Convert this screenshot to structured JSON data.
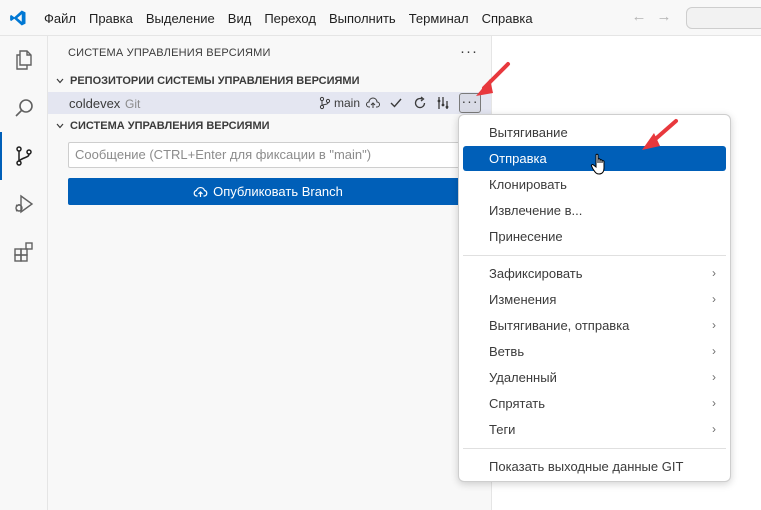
{
  "menubar": {
    "items": [
      "Файл",
      "Правка",
      "Выделение",
      "Вид",
      "Переход",
      "Выполнить",
      "Терминал",
      "Справка"
    ]
  },
  "activity_bar": {
    "items": [
      "explorer-icon",
      "search-icon",
      "source-control-icon",
      "run-debug-icon",
      "extensions-icon"
    ],
    "active": "source-control-icon"
  },
  "sidebar": {
    "header": "СИСТЕМА УПРАВЛЕНИЯ ВЕРСИЯМИ",
    "repos_section_title": "РЕПОЗИТОРИИ СИСТЕМЫ УПРАВЛЕНИЯ ВЕРСИЯМИ",
    "repo": {
      "name": "coldevex",
      "kind": "Git",
      "branch": "main"
    },
    "scm_section_title": "СИСТЕМА УПРАВЛЕНИЯ ВЕРСИЯМИ",
    "commit_placeholder": "Сообщение (CTRL+Enter для фиксации в \"main\")",
    "publish_label": "Опубликовать Branch"
  },
  "context_menu": {
    "group1": [
      "Вытягивание",
      "Отправка",
      "Клонировать",
      "Извлечение в...",
      "Принесение"
    ],
    "selected": "Отправка",
    "group2": [
      "Зафиксировать",
      "Изменения",
      "Вытягивание, отправка",
      "Ветвь",
      "Удаленный",
      "Спрятать",
      "Теги"
    ],
    "group3": [
      "Показать выходные данные GIT"
    ]
  },
  "colors": {
    "accent": "#005fb8",
    "annotation_arrow": "#e8383d"
  }
}
